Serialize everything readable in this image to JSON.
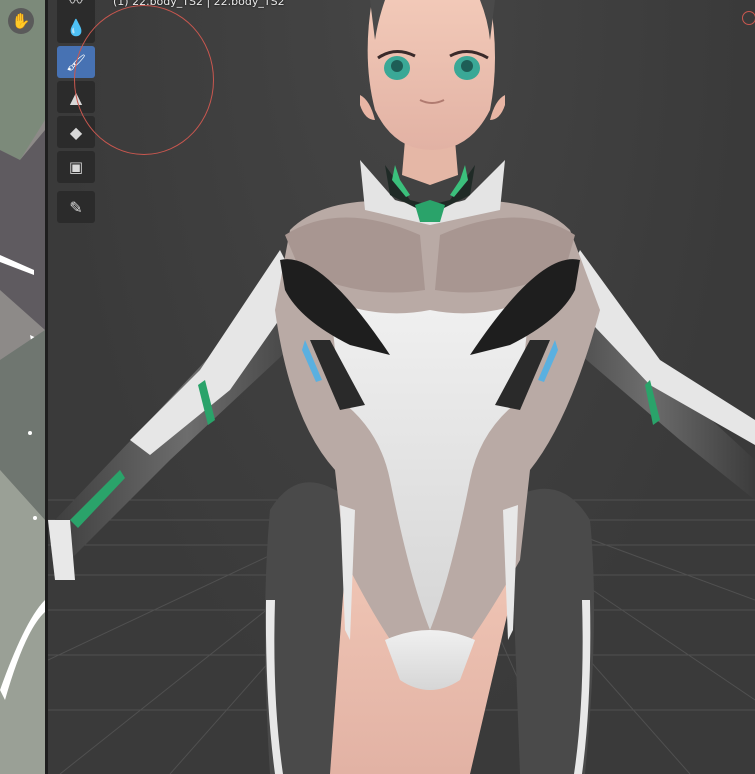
{
  "viewport": {
    "object_label": "(1) 22.body_TS2 | 22.body_TS2"
  },
  "tools": [
    {
      "name": "smear",
      "icon": "smear-icon",
      "active": false
    },
    {
      "name": "blur",
      "icon": "droplet-icon",
      "active": false
    },
    {
      "name": "draw",
      "icon": "brush-icon",
      "active": true
    },
    {
      "name": "clone",
      "icon": "stamp-icon",
      "active": false
    },
    {
      "name": "fill",
      "icon": "paint-bucket-icon",
      "active": false
    },
    {
      "name": "mask",
      "icon": "mask-icon",
      "active": false
    },
    {
      "name": "annotate",
      "icon": "annotate-pencil-icon",
      "active": false
    }
  ],
  "colors": {
    "accent": "#4772b3",
    "brush_cursor": "#c9574f",
    "viewport_bg": "#3d3d3d",
    "toolbar_bg": "#2b2b2b"
  }
}
